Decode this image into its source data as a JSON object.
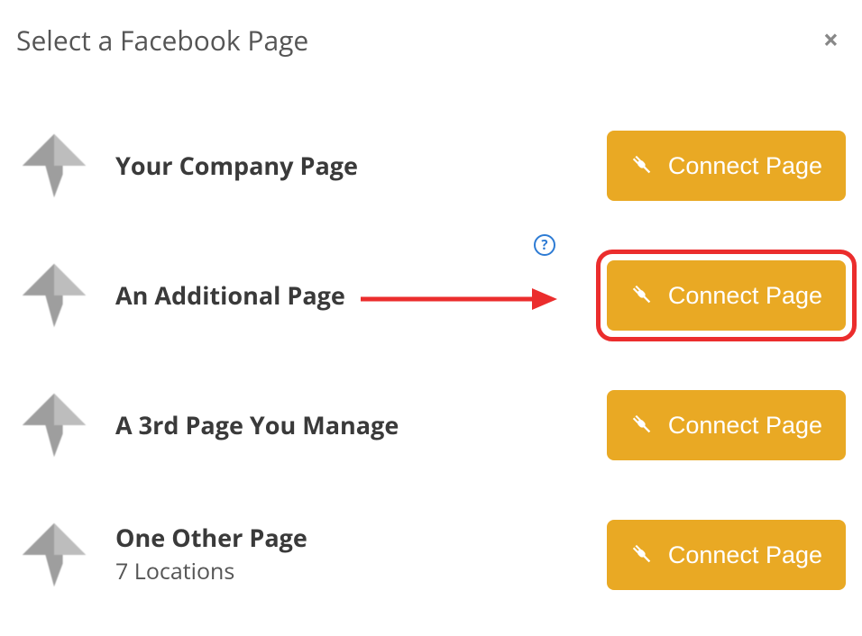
{
  "modal": {
    "title": "Select a Facebook Page",
    "close_glyph": "×",
    "help_glyph": "?",
    "connect_label": "Connect Page"
  },
  "pages": [
    {
      "name": "Your Company Page",
      "sub": ""
    },
    {
      "name": "An Additional Page",
      "sub": ""
    },
    {
      "name": "A 3rd Page You Manage",
      "sub": ""
    },
    {
      "name": "One Other Page",
      "sub": "7 Locations"
    }
  ],
  "highlight_index": 1,
  "colors": {
    "button_bg": "#e9a924",
    "button_fg": "#ffffff",
    "highlight": "#eb2d2d",
    "help": "#2d7bd4"
  }
}
